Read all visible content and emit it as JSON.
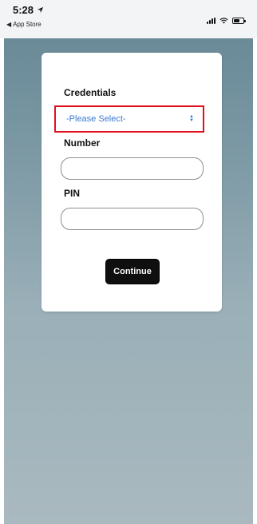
{
  "status_bar": {
    "time": "5:28",
    "back_label": "App Store",
    "icons": [
      "location-arrow-icon",
      "signal-icon",
      "wifi-icon",
      "battery-icon"
    ]
  },
  "form": {
    "credentials_label": "Credentials",
    "credentials_select_value": "-Please Select-",
    "number_label": "Number",
    "number_value": "",
    "pin_label": "PIN",
    "pin_value": "",
    "continue_label": "Continue"
  },
  "colors": {
    "highlight": "#e0101e",
    "select_text": "#3a7bd5",
    "button_bg": "#0f0f0f"
  }
}
